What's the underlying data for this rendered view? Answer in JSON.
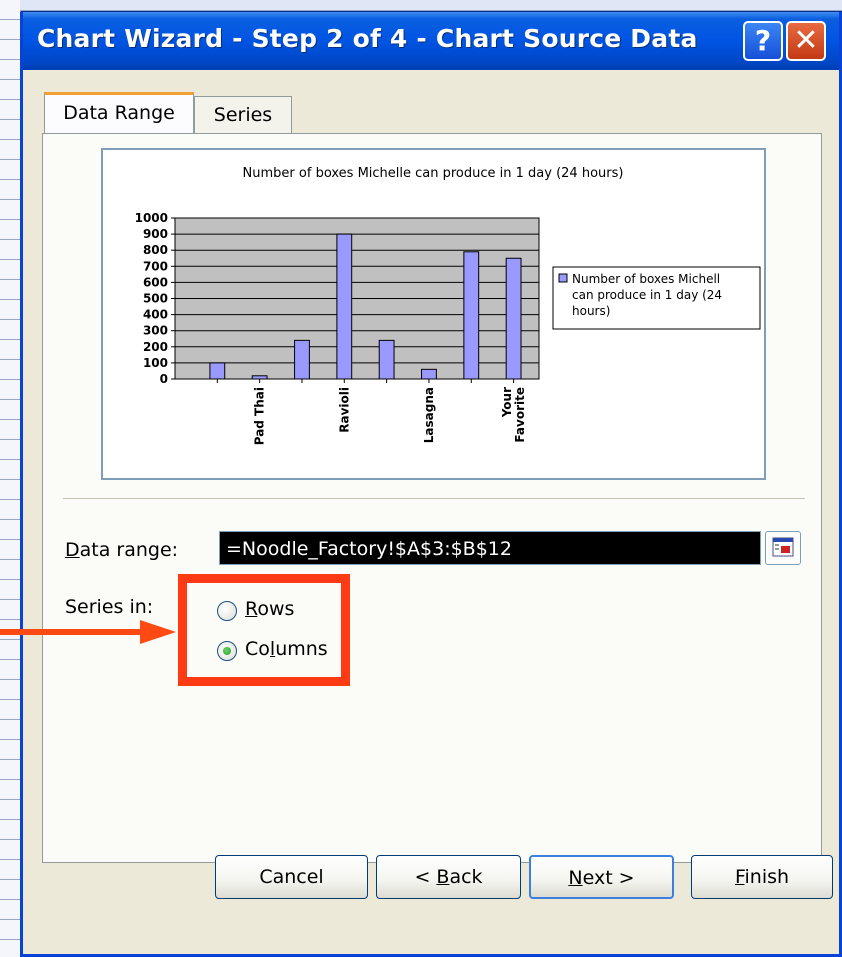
{
  "window": {
    "title": "Chart Wizard - Step 2 of 4 - Chart Source Data",
    "help_glyph": "?",
    "close_glyph": "✕"
  },
  "tabs": [
    {
      "label": "Data Range",
      "active": true
    },
    {
      "label": "Series",
      "active": false
    }
  ],
  "chart_data": {
    "type": "bar",
    "title": "Number of boxes Michelle can produce in 1 day (24 hours)",
    "categories": [
      "",
      "Pad Thai",
      "",
      "Ravioli",
      "",
      "Lasagna",
      "",
      "Your Favorite"
    ],
    "tick_labels": [
      "",
      "Pad Thai",
      "",
      "Ravioli",
      "",
      "Lasagna",
      "",
      "Your|Favorite"
    ],
    "series": [
      {
        "name": "Number of boxes Michelle can produce in 1 day (24 hours)",
        "values": [
          100,
          20,
          240,
          900,
          240,
          60,
          790,
          750
        ],
        "color": "#9999ff"
      }
    ],
    "legend_text": [
      "Number of boxes Michell",
      "can produce in 1 day (24",
      "hours)"
    ],
    "yticks": [
      "0",
      "100",
      "200",
      "300",
      "400",
      "500",
      "600",
      "700",
      "800",
      "900",
      "1000"
    ],
    "ylim": [
      0,
      1000
    ],
    "plot_bg": "#c0c0c0",
    "grid": true,
    "legend_position": "right"
  },
  "form": {
    "data_range_label_accel": "D",
    "data_range_label_rest": "ata range:",
    "data_range_value": "=Noodle_Factory!$A$3:$B$12",
    "series_in_label": "Series in:",
    "rows_accel": "R",
    "rows_rest": "ows",
    "columns_pre": "Co",
    "columns_accel": "l",
    "columns_rest": "umns",
    "selected": "Columns"
  },
  "buttons": {
    "cancel": "Cancel",
    "back_pre": "< ",
    "back_accel": "B",
    "back_rest": "ack",
    "next_accel": "N",
    "next_rest": "ext >",
    "finish_accel": "F",
    "finish_rest": "inish"
  },
  "annotation": {
    "highlight_color": "#ff3b16",
    "arrow_color": "#ff4a14"
  }
}
